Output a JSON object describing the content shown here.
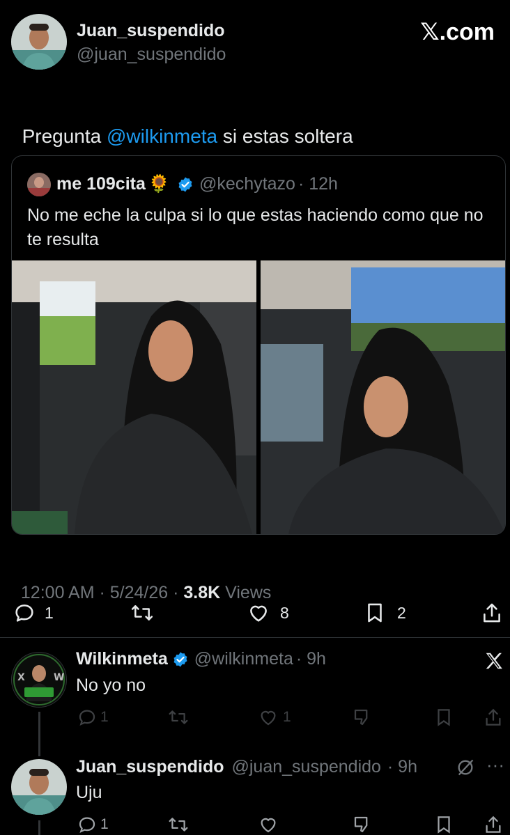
{
  "header": {
    "display_name": "Juan_suspendido",
    "handle": "@juan_suspendido",
    "brand": "𝕏.com"
  },
  "tweet": {
    "text_before": "Pregunta ",
    "mention": "@wilkinmeta",
    "text_after": " si estas soltera",
    "timestamp": "12:00 AM · 5/24/26 · ",
    "views_count": "3.8K",
    "views_label": " Views"
  },
  "quote": {
    "display_name": "me 109cita",
    "emoji": "🌻",
    "handle": "@kechytazo",
    "time": "· 12h",
    "text": "No me eche la culpa si lo que estas haciendo como que no te resulta"
  },
  "actions": {
    "replies": "1",
    "likes": "8",
    "bookmarks": "2"
  },
  "replies": [
    {
      "display_name": "Wilkinmeta",
      "handle": "@wilkinmeta",
      "time": "· 9h",
      "text": "No yo no",
      "reply_count": "1",
      "like_count": "1"
    },
    {
      "display_name": "Juan_suspendido",
      "handle": "@juan_suspendido",
      "time": "· 9h",
      "text": "Uju",
      "reply_count": "1"
    }
  ],
  "colors": {
    "background": "#000000",
    "text": "#e7e9ea",
    "muted": "#71767b",
    "accent": "#1d9bf0",
    "border": "#2f3336"
  }
}
